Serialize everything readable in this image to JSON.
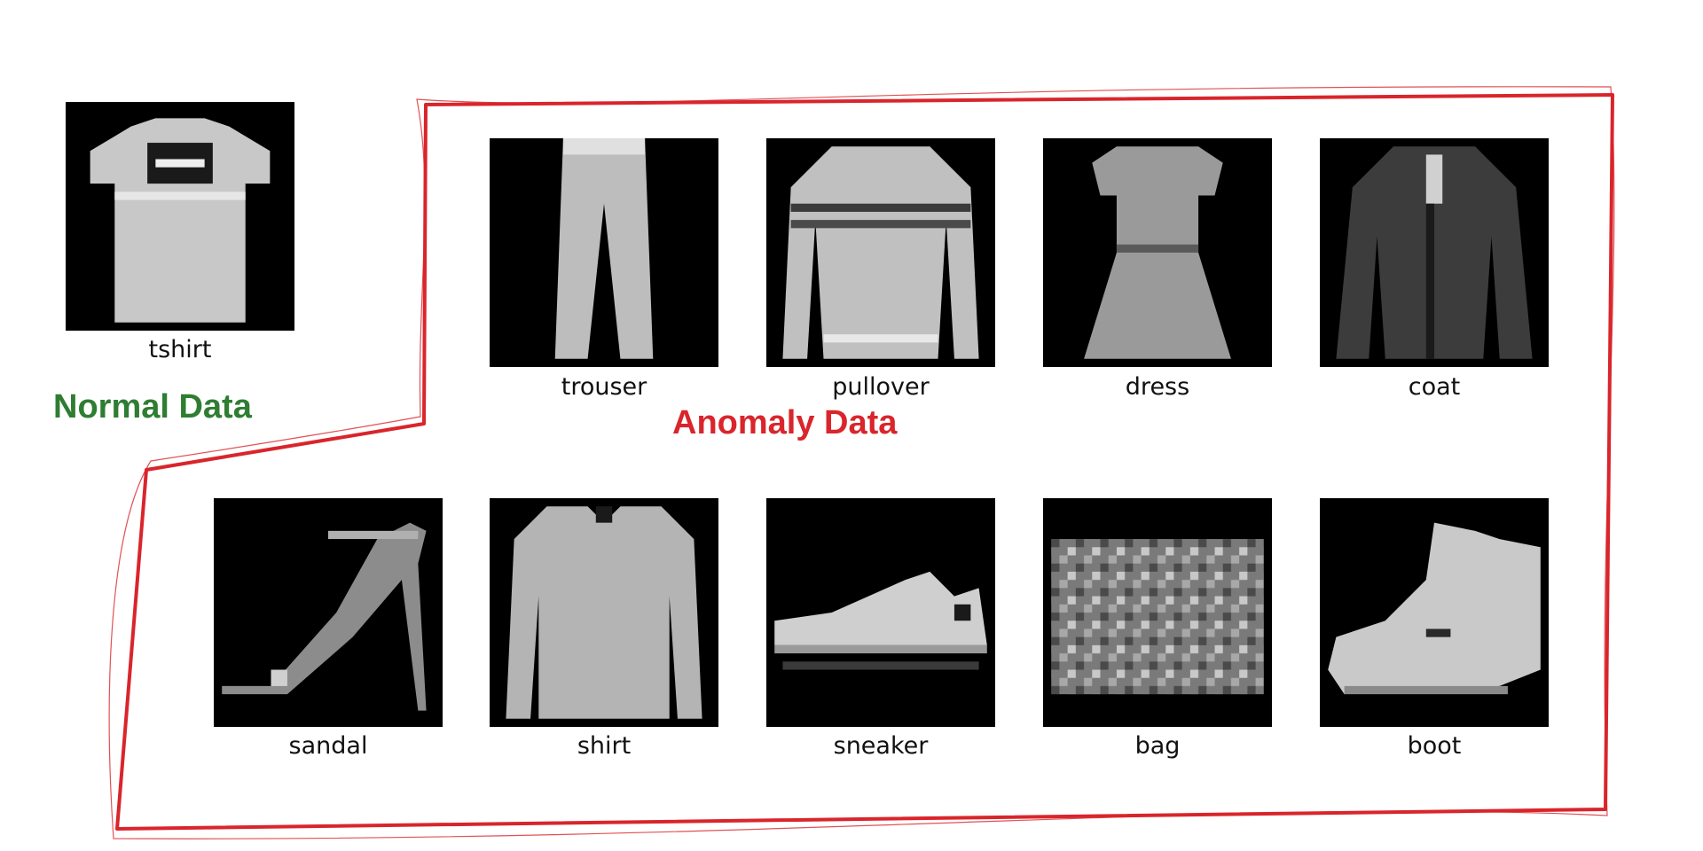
{
  "normal": {
    "label": "Normal Data",
    "label_color": "#2e7d32",
    "items": [
      {
        "caption": "tshirt",
        "icon": "tshirt-icon"
      }
    ]
  },
  "anomaly": {
    "label": "Anomaly Data",
    "label_color": "#d9252b",
    "outline_color": "#d9252b",
    "items": [
      {
        "caption": "trouser",
        "icon": "trouser-icon"
      },
      {
        "caption": "pullover",
        "icon": "pullover-icon"
      },
      {
        "caption": "dress",
        "icon": "dress-icon"
      },
      {
        "caption": "coat",
        "icon": "coat-icon"
      },
      {
        "caption": "sandal",
        "icon": "sandal-icon"
      },
      {
        "caption": "shirt",
        "icon": "shirt-icon"
      },
      {
        "caption": "sneaker",
        "icon": "sneaker-icon"
      },
      {
        "caption": "bag",
        "icon": "bag-icon"
      },
      {
        "caption": "boot",
        "icon": "boot-icon"
      }
    ]
  }
}
